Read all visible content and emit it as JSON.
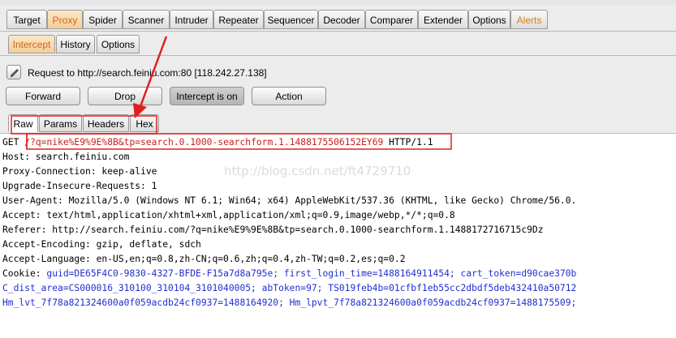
{
  "top_tabs": [
    {
      "label": "Target",
      "selected": false
    },
    {
      "label": "Proxy",
      "selected": true
    },
    {
      "label": "Spider",
      "selected": false
    },
    {
      "label": "Scanner",
      "selected": false
    },
    {
      "label": "Intruder",
      "selected": false
    },
    {
      "label": "Repeater",
      "selected": false
    },
    {
      "label": "Sequencer",
      "selected": false
    },
    {
      "label": "Decoder",
      "selected": false
    },
    {
      "label": "Comparer",
      "selected": false
    },
    {
      "label": "Extender",
      "selected": false
    },
    {
      "label": "Options",
      "selected": false
    },
    {
      "label": "Alerts",
      "selected": false
    }
  ],
  "sub_tabs": [
    {
      "label": "Intercept",
      "selected": true
    },
    {
      "label": "History",
      "selected": false
    },
    {
      "label": "Options",
      "selected": false
    }
  ],
  "request_info": {
    "text": "Request to http://search.feiniu.com:80  [118.242.27.138]"
  },
  "buttons": {
    "forward": "Forward",
    "drop": "Drop",
    "intercept": "Intercept is on",
    "action": "Action"
  },
  "view_tabs": [
    {
      "label": "Raw",
      "selected": true
    },
    {
      "label": "Params",
      "selected": false
    },
    {
      "label": "Headers",
      "selected": false
    },
    {
      "label": "Hex",
      "selected": false
    }
  ],
  "request_lines": {
    "l1a": "GET ",
    "l1b": "/?q=nike%E9%9E%8B&tp=search.0.1000-searchform.1.1488175506152EY69",
    "l1c": " HTTP/1.1",
    "l2": "Host: search.feiniu.com",
    "l3": "Proxy-Connection: keep-alive",
    "l4": "Upgrade-Insecure-Requests: 1",
    "l5": "User-Agent: Mozilla/5.0 (Windows NT 6.1; Win64; x64) AppleWebKit/537.36 (KHTML, like Gecko) Chrome/56.0.",
    "l6": "Accept: text/html,application/xhtml+xml,application/xml;q=0.9,image/webp,*/*;q=0.8",
    "l7": "Referer: http://search.feiniu.com/?q=nike%E9%9E%8B&tp=search.0.1000-searchform.1.1488172716715c9Dz",
    "l8": "Accept-Encoding: gzip, deflate, sdch",
    "l9": "Accept-Language: en-US,en;q=0.8,zh-CN;q=0.6,zh;q=0.4,zh-TW;q=0.2,es;q=0.2",
    "cookie_label": "Cookie: ",
    "c1": "guid=DE65F4C0-9830-4327-BFDE-F15a7d8a795e; first_login_time=1488164911454; cart_token=d90cae370b",
    "c2": "C_dist_area=CS000016_310100_310104_3101040005; abToken=97; TS019feb4b=01cfbf1eb55cc2dbdf5deb432410a50712",
    "c3": "Hm_lvt_7f78a821324600a0f059acdb24cf0937=1488164920; Hm_lpvt_7f78a821324600a0f059acdb24cf0937=1488175509;"
  },
  "watermark": "http://blog.csdn.net/ft4729710",
  "colors": {
    "selected_tab": "#f3cf98",
    "selected_text": "#d3661a",
    "cookie_value": "#1f2fd0",
    "annotation": "#e02020"
  }
}
